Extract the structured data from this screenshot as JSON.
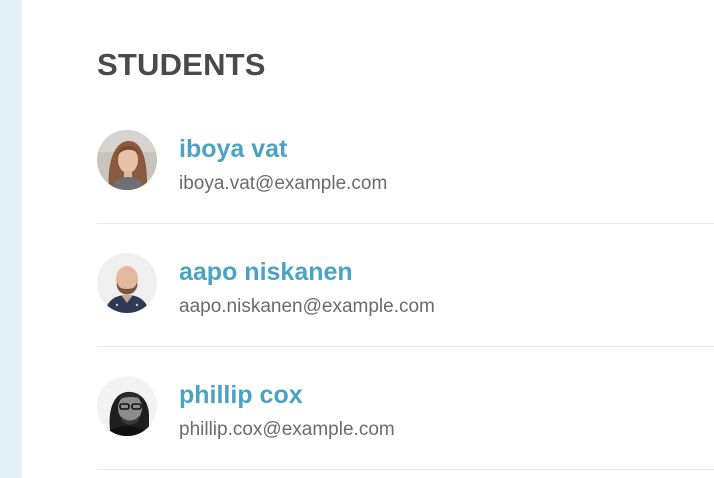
{
  "section": {
    "title": "STUDENTS"
  },
  "students": [
    {
      "name": "iboya vat",
      "email": "iboya.vat@example.com"
    },
    {
      "name": "aapo niskanen",
      "email": "aapo.niskanen@example.com"
    },
    {
      "name": "phillip cox",
      "email": "phillip.cox@example.com"
    }
  ],
  "colors": {
    "name_link": "#4ba3c3",
    "email_text": "#6b6b6b",
    "title_text": "#4a4a4a",
    "side_strip": "#e3f1f7",
    "divider": "#e6e6e6"
  }
}
